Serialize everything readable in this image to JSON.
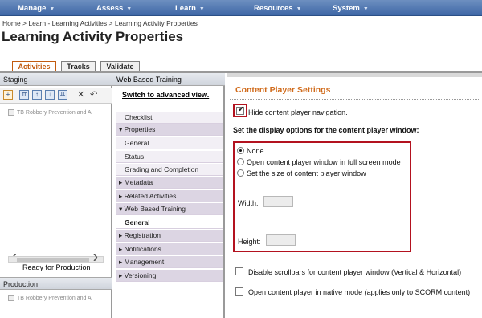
{
  "nav": {
    "items": [
      {
        "label": "Manage"
      },
      {
        "label": "Assess"
      },
      {
        "label": "Learn"
      },
      {
        "label": "Resources"
      },
      {
        "label": "System"
      }
    ],
    "caret": "▼"
  },
  "breadcrumb": "Home > Learn - Learning Activities > Learning Activity Properties",
  "page_title": "Learning Activity Properties",
  "tabs": [
    {
      "label": "Activities",
      "active": true
    },
    {
      "label": "Tracks",
      "active": false
    },
    {
      "label": "Validate",
      "active": false
    }
  ],
  "staging": {
    "header": "Staging",
    "tree_item": "TB Robbery Prevention and A",
    "ready_link": "Ready for Production"
  },
  "production": {
    "header": "Production",
    "tree_item": "TB Robbery Prevention and A"
  },
  "middle": {
    "header": "Web Based Training",
    "switch_link": "Switch to advanced view.",
    "rows": [
      {
        "label": "Checklist",
        "kind": "sub"
      },
      {
        "label": "▾ Properties",
        "kind": "sect"
      },
      {
        "label": "General",
        "kind": "sub"
      },
      {
        "label": "Status",
        "kind": "sub"
      },
      {
        "label": "Grading and Completion",
        "kind": "sub"
      },
      {
        "label": "▸ Metadata",
        "kind": "sect"
      },
      {
        "label": "▸ Related Activities",
        "kind": "sect"
      },
      {
        "label": "▾ Web Based Training",
        "kind": "sect"
      },
      {
        "label": "General",
        "kind": "current"
      },
      {
        "label": "▸ Registration",
        "kind": "sect"
      },
      {
        "label": "▸ Notifications",
        "kind": "sect"
      },
      {
        "label": "▸ Management",
        "kind": "sect"
      },
      {
        "label": "▸ Versioning",
        "kind": "sect"
      }
    ]
  },
  "content": {
    "title": "Content Player Settings",
    "hide_nav": {
      "label": "Hide content player navigation.",
      "checked": true
    },
    "display_heading": "Set the display options for the content player window:",
    "options": [
      {
        "label": "None",
        "selected": true
      },
      {
        "label": "Open content player window in full screen mode",
        "selected": false
      },
      {
        "label": "Set the size of content player window",
        "selected": false
      }
    ],
    "width_label": "Width:",
    "width_value": "",
    "height_label": "Height:",
    "height_value": "",
    "disable_scrollbars": {
      "label": "Disable scrollbars for content player window (Vertical & Horizontal)",
      "checked": false
    },
    "native_mode": {
      "label": "Open content player in native mode (applies only to SCORM content)",
      "checked": false
    }
  },
  "colors": {
    "nav_bar": "#3e67a6",
    "active_tab": "#c25b0f",
    "section_title": "#d06a1a",
    "highlight_border": "#b3121f"
  }
}
